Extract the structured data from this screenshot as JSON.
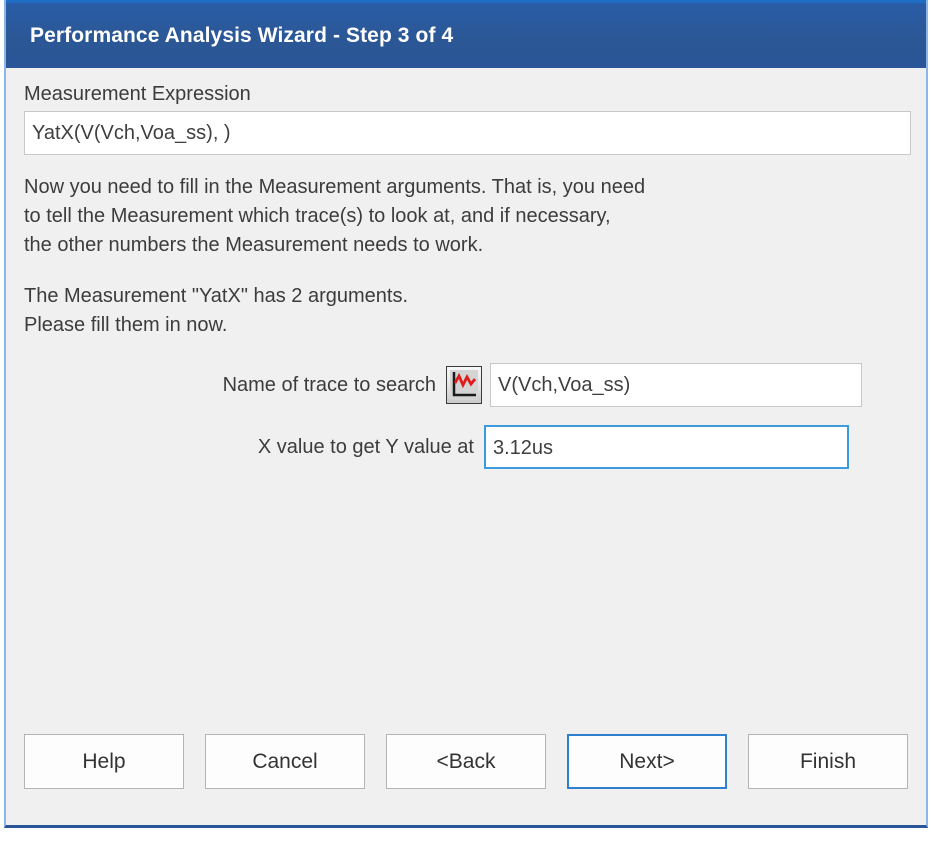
{
  "window": {
    "title": "Performance Analysis Wizard - Step 3 of 4",
    "accent_color": "#2a5699",
    "title_text_color": "#ffffff",
    "client_background": "#f0f0f0"
  },
  "expression": {
    "label": "Measurement Expression",
    "value": "YatX(V(Vch,Voa_ss), )",
    "placeholder": ""
  },
  "instructions": {
    "paragraph1": "Now you need to fill in the Measurement arguments.  That is, you need\nto tell the Measurement which trace(s) to look at, and if necessary,\nthe other numbers the Measurement needs to work.",
    "paragraph2": "The Measurement \"YatX\" has 2 arguments.\nPlease fill them in now."
  },
  "arguments": [
    {
      "label": "Name of trace to search",
      "value": "V(Vch,Voa_ss)",
      "placeholder": "",
      "has_picker": true,
      "picker_icon": "trace-waveform-icon",
      "picker_icon_color": "#e01b1b",
      "focused": false
    },
    {
      "label": "X value to get Y value at",
      "value": "3.12us",
      "placeholder": "",
      "has_picker": false,
      "focused": true,
      "focus_color": "#3b9bdf"
    }
  ],
  "buttons": [
    {
      "label": "Help",
      "default": false
    },
    {
      "label": "Cancel",
      "default": false
    },
    {
      "label": "<Back",
      "default": false
    },
    {
      "label": "Next>",
      "default": true
    },
    {
      "label": "Finish",
      "default": false
    }
  ]
}
